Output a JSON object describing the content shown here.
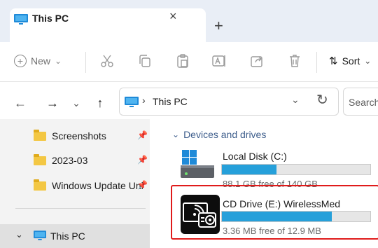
{
  "window": {
    "tab_title": "This PC",
    "close_symbol": "×",
    "new_tab_symbol": "+"
  },
  "toolbar": {
    "new_label": "New",
    "new_chevron": "⌄",
    "sort_label": "Sort",
    "sort_chevron": "⌄",
    "icons": [
      "cut-icon",
      "copy-icon",
      "paste-icon",
      "rename-icon",
      "share-icon",
      "delete-icon"
    ]
  },
  "address_bar": {
    "breadcrumb": "This PC",
    "separator": "›",
    "dropdown_symbol": "⌄",
    "refresh_symbol": "↻",
    "search_placeholder": "Search"
  },
  "nav": {
    "back": "←",
    "forward": "→",
    "recent": "⌄",
    "up": "↑"
  },
  "sidebar": {
    "items": [
      {
        "label": "Screenshots",
        "pinned": true
      },
      {
        "label": "2023-03",
        "pinned": true
      },
      {
        "label": "Windows Update Uni",
        "pinned": true
      }
    ],
    "this_pc": {
      "label": "This PC",
      "expand": "⌄"
    },
    "pin_symbol": "📌"
  },
  "main": {
    "group_title": "Devices and drives",
    "group_chevron": "⌄",
    "drives": [
      {
        "name": "Local Disk (C:)",
        "free_text": "88.1 GB free of 140 GB",
        "used_fraction": 0.37
      },
      {
        "name": "CD Drive (E:) WirelessMed",
        "free_text": "3.36 MB free of 12.9 MB",
        "used_fraction": 0.74
      }
    ]
  },
  "colors": {
    "accent": "#26a0da",
    "highlight": "#e01b1b",
    "tabstrip": "#e9eef6"
  }
}
